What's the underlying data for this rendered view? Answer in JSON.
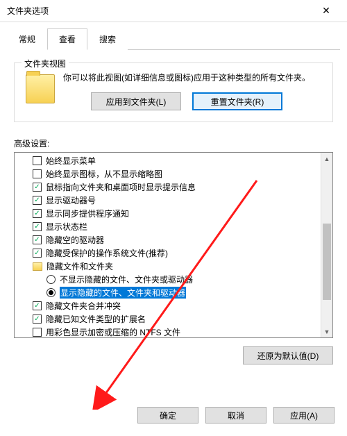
{
  "window": {
    "title": "文件夹选项",
    "close": "✕"
  },
  "tabs": [
    {
      "label": "常规",
      "active": false
    },
    {
      "label": "查看",
      "active": true
    },
    {
      "label": "搜索",
      "active": false
    }
  ],
  "folderViews": {
    "legend": "文件夹视图",
    "desc": "你可以将此视图(如详细信息或图标)应用于这种类型的所有文件夹。",
    "applyBtn": "应用到文件夹(L)",
    "resetBtn": "重置文件夹(R)"
  },
  "advancedLabel": "高级设置:",
  "items": [
    {
      "type": "check",
      "checked": false,
      "indent": 1,
      "label": "始终显示菜单"
    },
    {
      "type": "check",
      "checked": false,
      "indent": 1,
      "label": "始终显示图标，从不显示缩略图"
    },
    {
      "type": "check",
      "checked": true,
      "indent": 1,
      "label": "鼠标指向文件夹和桌面项时显示提示信息"
    },
    {
      "type": "check",
      "checked": true,
      "indent": 1,
      "label": "显示驱动器号"
    },
    {
      "type": "check",
      "checked": true,
      "indent": 1,
      "label": "显示同步提供程序通知"
    },
    {
      "type": "check",
      "checked": true,
      "indent": 1,
      "label": "显示状态栏"
    },
    {
      "type": "check",
      "checked": true,
      "indent": 1,
      "label": "隐藏空的驱动器"
    },
    {
      "type": "check",
      "checked": true,
      "indent": 1,
      "label": "隐藏受保护的操作系统文件(推荐)"
    },
    {
      "type": "folder",
      "indent": 1,
      "label": "隐藏文件和文件夹"
    },
    {
      "type": "radio",
      "checked": false,
      "indent": 2,
      "label": "不显示隐藏的文件、文件夹或驱动器"
    },
    {
      "type": "radio",
      "checked": true,
      "indent": 2,
      "label": "显示隐藏的文件、文件夹和驱动器",
      "hilite": true
    },
    {
      "type": "check",
      "checked": true,
      "indent": 1,
      "label": "隐藏文件夹合并冲突"
    },
    {
      "type": "check",
      "checked": true,
      "indent": 1,
      "label": "隐藏已知文件类型的扩展名"
    },
    {
      "type": "check",
      "checked": false,
      "indent": 1,
      "label": "用彩色显示加密或压缩的 NTFS 文件"
    }
  ],
  "restoreBtn": "还原为默认值(D)",
  "footer": {
    "ok": "确定",
    "cancel": "取消",
    "apply": "应用(A)"
  }
}
